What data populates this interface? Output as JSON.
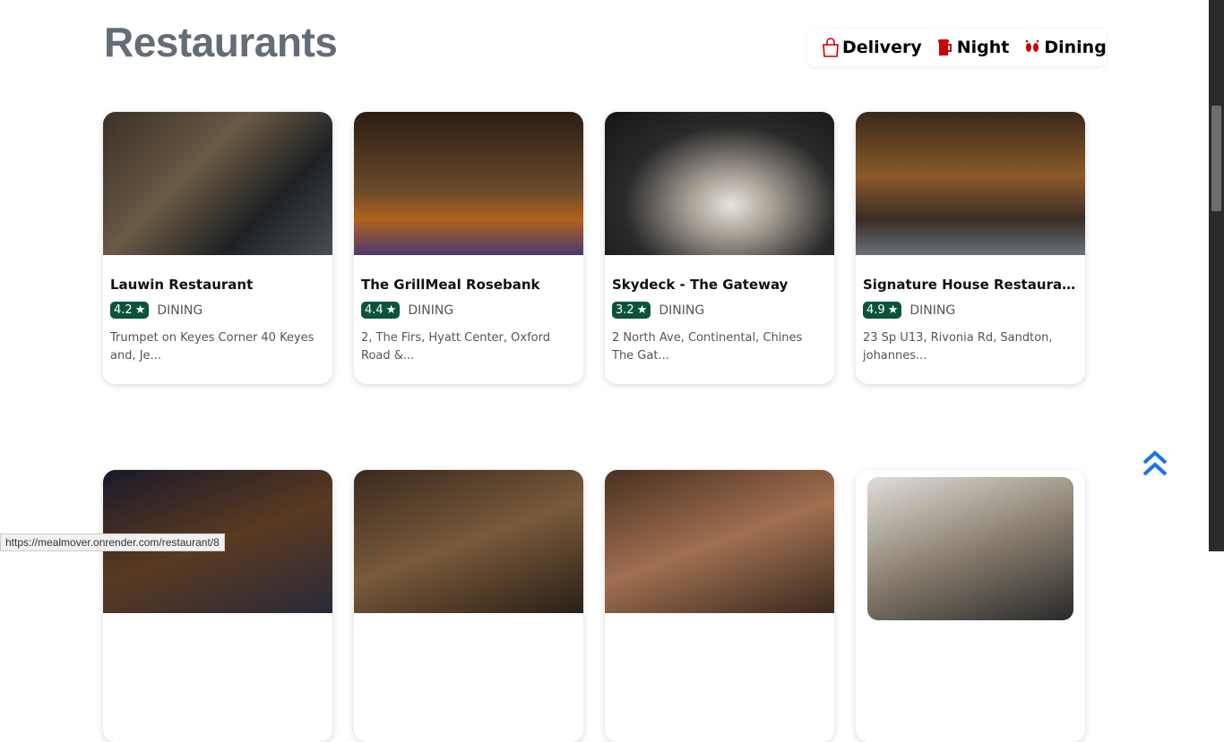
{
  "page": {
    "title": "Restaurants"
  },
  "filters": [
    {
      "label": "Delivery",
      "icon": "shopping-bag-icon"
    },
    {
      "label": "Night",
      "icon": "beer-mug-icon"
    },
    {
      "label": "Dining",
      "icon": "footprints-icon"
    }
  ],
  "colors": {
    "accent": "#cc0000",
    "badge": "#0b5439",
    "scroll_up": "#1a73e8"
  },
  "restaurants": [
    {
      "name": "Lauwin Restaurant",
      "rating": "4.2",
      "type": "DINING",
      "address": "Trumpet on Keyes Corner 40 Keyes and, Je..."
    },
    {
      "name": "The GrillMeal Rosebank",
      "rating": "4.4",
      "type": "DINING",
      "address": "2, The Firs, Hyatt Center, Oxford Road &..."
    },
    {
      "name": "Skydeck - The Gateway",
      "rating": "3.2",
      "type": "DINING",
      "address": "2 North Ave, Continental, Chines The Gat..."
    },
    {
      "name": "Signature House Restauran...",
      "rating": "4.9",
      "type": "DINING",
      "address": "23 Sp U13, Rivonia Rd, Sandton, johannes..."
    }
  ],
  "status_url": "https://mealmover.onrender.com/restaurant/8"
}
